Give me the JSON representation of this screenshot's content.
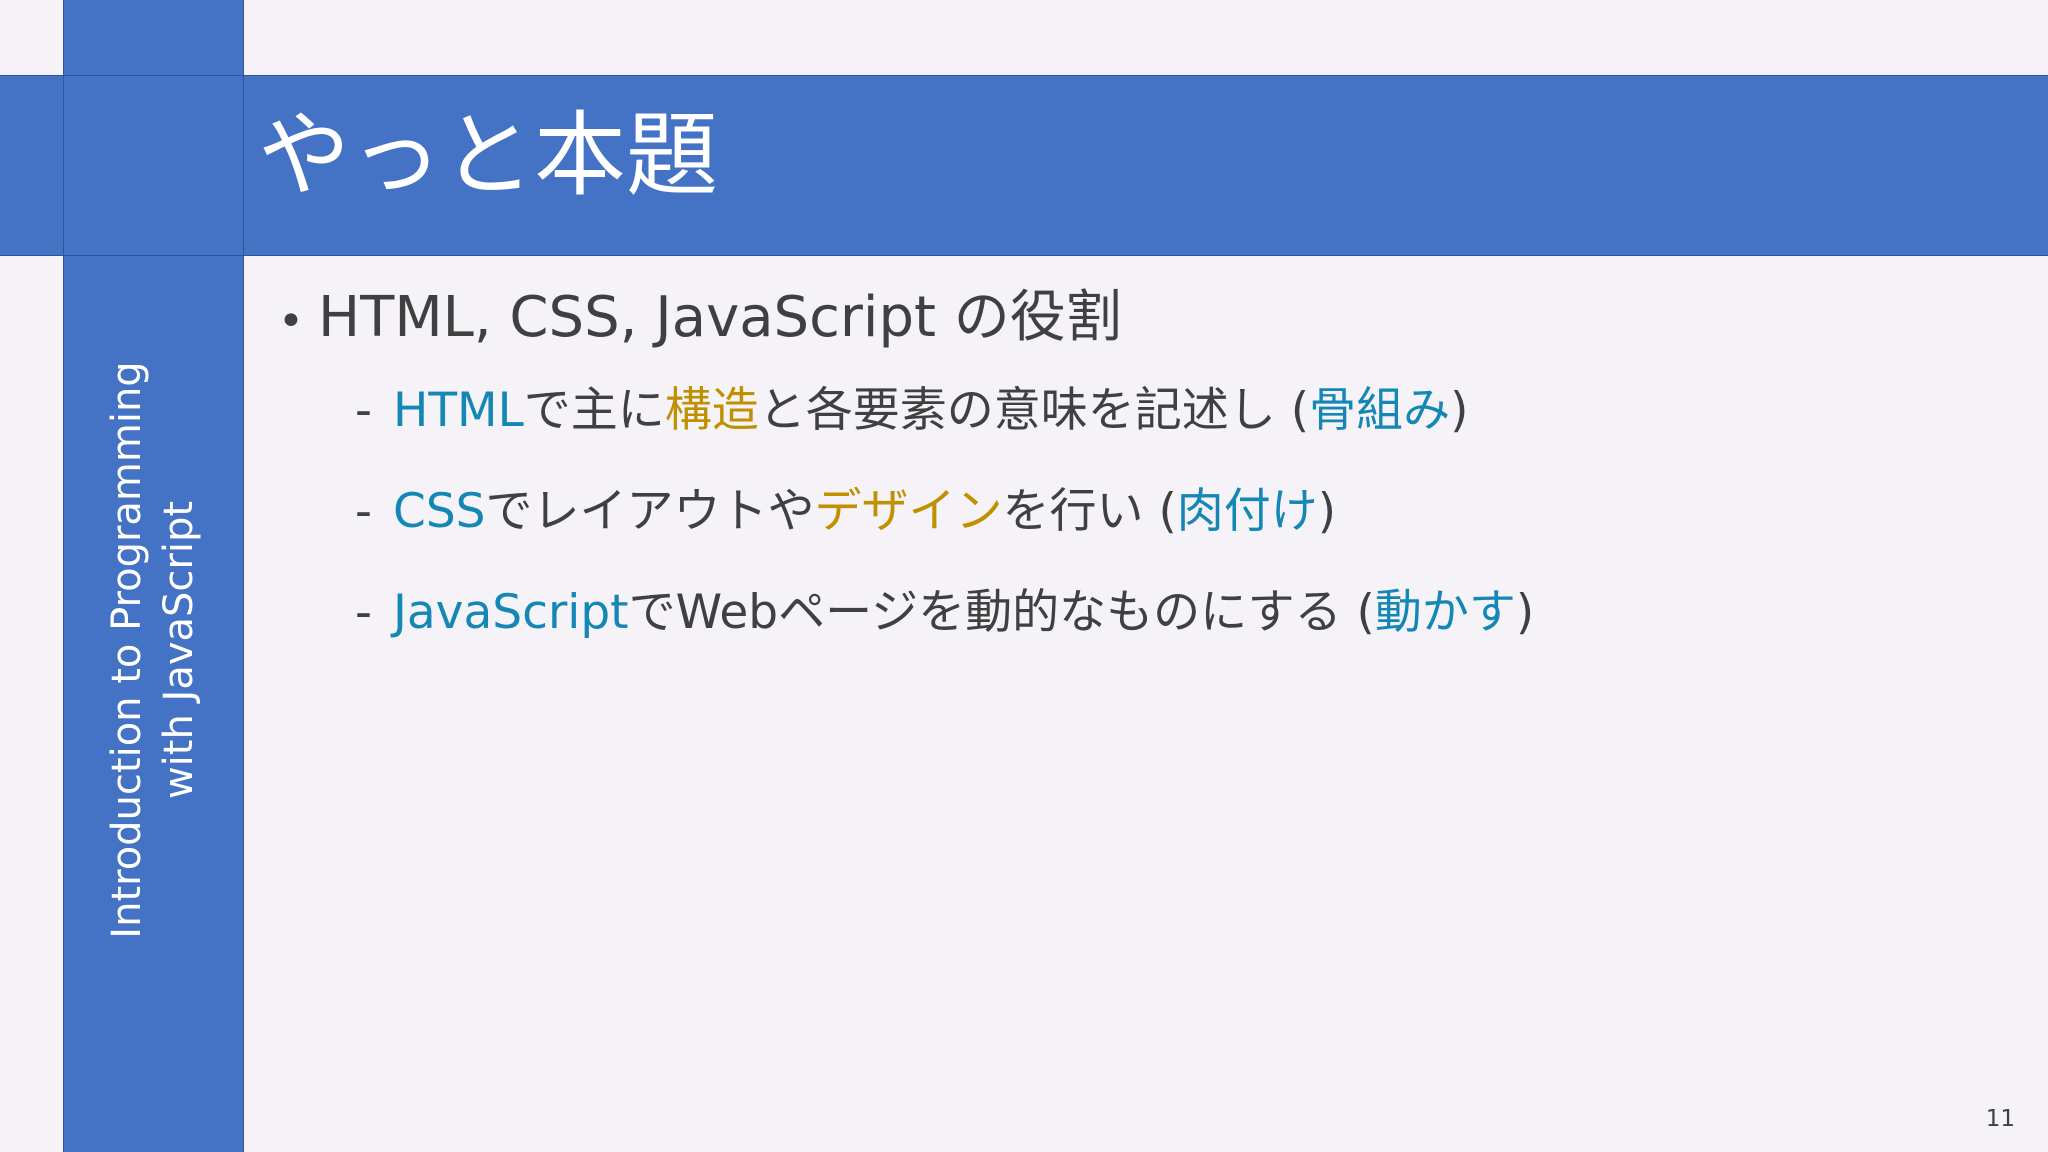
{
  "slide": {
    "side_title_line1": "Introduction to Programming",
    "side_title_line2": "with JavaScript",
    "title": "やっと本題",
    "bullet": "HTML, CSS, JavaScript の役割",
    "bullet_marker": "•",
    "dash_marker": "-",
    "items": [
      {
        "segments": [
          {
            "text": "HTML",
            "style": "blue"
          },
          {
            "text": "で主に",
            "style": "plain"
          },
          {
            "text": "構造",
            "style": "gold"
          },
          {
            "text": "と各要素の意味を記述し (",
            "style": "plain"
          },
          {
            "text": "骨組み",
            "style": "blue"
          },
          {
            "text": ")",
            "style": "plain"
          }
        ]
      },
      {
        "segments": [
          {
            "text": "CSS",
            "style": "blue"
          },
          {
            "text": "でレイアウトや",
            "style": "plain"
          },
          {
            "text": "デザイン",
            "style": "gold"
          },
          {
            "text": "を行い (",
            "style": "plain"
          },
          {
            "text": "肉付け",
            "style": "blue"
          },
          {
            "text": ")",
            "style": "plain"
          }
        ]
      },
      {
        "segments": [
          {
            "text": "JavaScript",
            "style": "blue"
          },
          {
            "text": "でWebページを動的なものにする (",
            "style": "plain"
          },
          {
            "text": "動かす",
            "style": "blue"
          },
          {
            "text": ")",
            "style": "plain"
          }
        ]
      }
    ],
    "page_number": "11"
  },
  "colors": {
    "accent": "#4472c4",
    "keyword_blue": "#1487b4",
    "keyword_gold": "#bf9000",
    "body_text": "#404040",
    "background": "#f5f3f8"
  }
}
